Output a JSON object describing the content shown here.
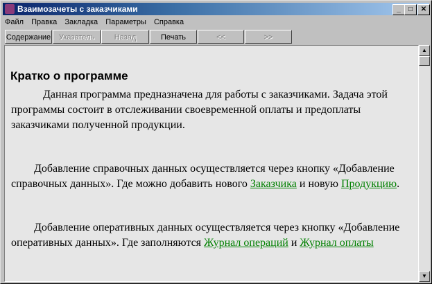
{
  "window": {
    "title": "Взаимозачеты с заказчиками",
    "minimize": "_",
    "maximize": "□",
    "close": "✕"
  },
  "menu": [
    "Файл",
    "Правка",
    "Закладка",
    "Параметры",
    "Справка"
  ],
  "toolbar": {
    "contents": "Содержание",
    "index": "Указатель",
    "back": "Назад",
    "print": "Печать",
    "prev": "<<",
    "next": ">>"
  },
  "content": {
    "heading": "Кратко о программе",
    "p1": "Данная программа предназначена для работы с заказчиками. Задача этой программы состоит в отслеживании своевременной оплаты и предоплаты заказчиками полученной продукции.",
    "p2_text": "Добавление справочных данных осуществляется через кнопку «Добавление справочных данных». Где можно добавить нового ",
    "p2_link1": "Заказчика",
    "p2_mid": "  и новую ",
    "p2_link2": "Продукцию",
    "p2_end": ".",
    "p3_text": "Добавление оперативных данных осуществляется через кнопку «Добавление оперативных данных». Где заполняются ",
    "p3_link1": "Журнал операций",
    "p3_mid": " и ",
    "p3_link2": "Журнал оплаты"
  }
}
